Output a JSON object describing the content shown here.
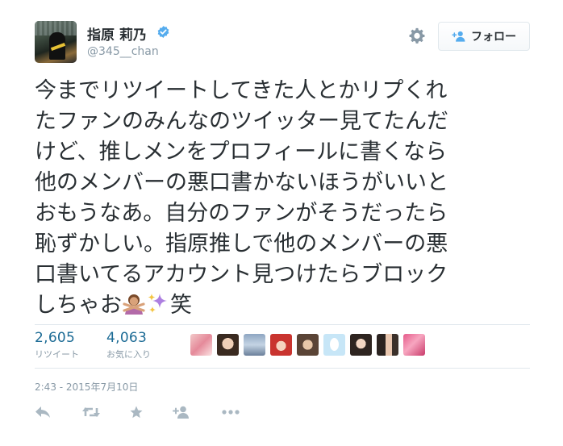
{
  "user": {
    "display_name": "指原 莉乃",
    "handle": "@345__chan",
    "verified": true
  },
  "follow_button": {
    "label": "フォロー"
  },
  "tweet": {
    "lines": [
      "今までリツイートしてきた人とかリプくれ",
      "たファンのみんなのツイッター見てたんだ",
      "けど、推しメンをプロフィールに書くなら",
      "他のメンバーの悪口書かないほうがいいと",
      "おもうなあ。自分のファンがそうだったら",
      "恥ずかしい。指原推しで他のメンバーの悪",
      "口書いてるアカウント見つけたらブロック",
      "しちゃお"
    ],
    "trailing_text": "笑",
    "emojis": [
      "no-gesture-woman-emoji",
      "sparkles-emoji"
    ]
  },
  "stats": {
    "retweets": {
      "count": "2,605",
      "label": "リツイート"
    },
    "likes": {
      "count": "4,063",
      "label": "お気に入り"
    }
  },
  "favoriters": [
    {
      "name": "favoriter-1"
    },
    {
      "name": "favoriter-2"
    },
    {
      "name": "favoriter-3"
    },
    {
      "name": "favoriter-4"
    },
    {
      "name": "favoriter-5"
    },
    {
      "name": "favoriter-6"
    },
    {
      "name": "favoriter-7"
    },
    {
      "name": "favoriter-8"
    },
    {
      "name": "favoriter-9"
    }
  ],
  "timestamp": "2:43 - 2015年7月10日",
  "actions": [
    "reply-icon",
    "retweet-icon",
    "favorite-icon",
    "follow-icon",
    "more-icon"
  ],
  "colors": {
    "text": "#292f33",
    "muted": "#8899a6",
    "link": "#1c6b95",
    "verified": "#55acee",
    "border": "#e1e8ed",
    "action_icon": "#aab8c2"
  }
}
